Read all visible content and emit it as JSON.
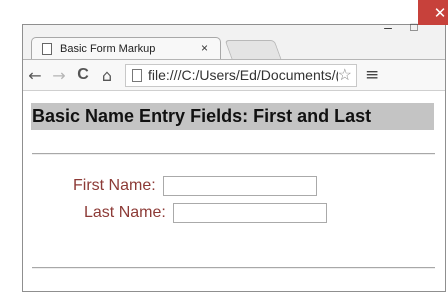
{
  "window": {
    "minimize_glyph": "–",
    "maximize_glyph": "□",
    "close_glyph": "✕",
    "close_color": "#c7413b"
  },
  "tab": {
    "title": "Basic Form Markup",
    "close_glyph": "×",
    "icon": "page-icon"
  },
  "toolbar": {
    "back_glyph": "←",
    "forward_glyph": "→",
    "reload_glyph": "C",
    "home_glyph": "⌂",
    "url": "file:///C:/Users/Ed/Documents/(",
    "star_glyph": "☆",
    "menu_glyph": "≡"
  },
  "page": {
    "heading": "Basic Name Entry Fields: First and Last",
    "first_name_label": "First Name:",
    "first_name_value": "",
    "last_name_label": "Last Name:",
    "last_name_value": "",
    "heading_bg": "#c4c4c4",
    "label_color": "#8c3a36"
  }
}
